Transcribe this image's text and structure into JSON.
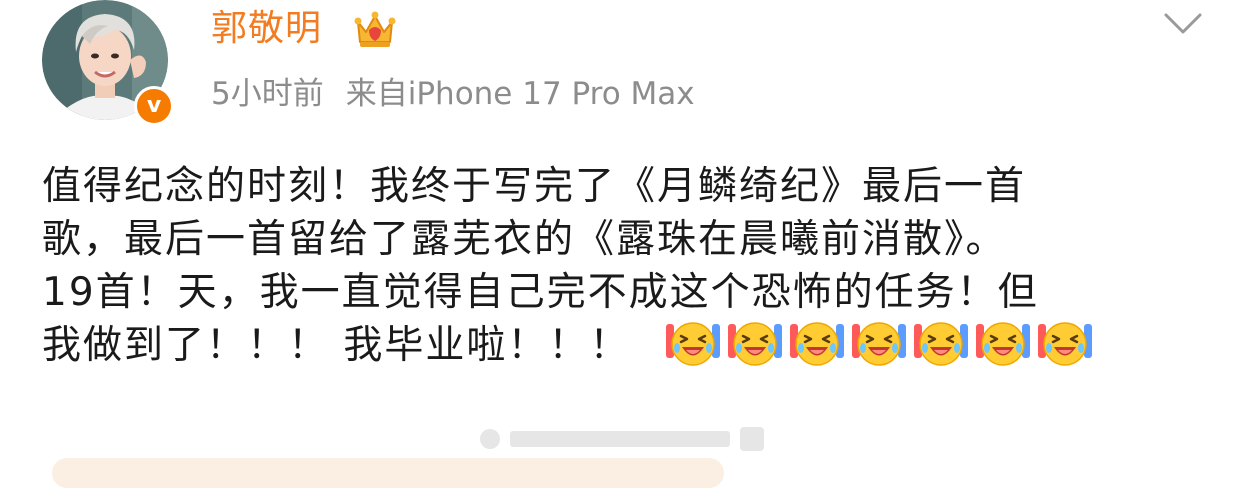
{
  "post": {
    "username": "郭敬明",
    "time": "5小时前",
    "source": "来自iPhone 17 Pro Max",
    "lines": [
      "值得纪念的时刻！我终于写完了《月鳞绮纪》最后一首",
      "歌，最后一首留给了露芜衣的《露珠在晨曦前消散》。",
      "19首！天，我一直觉得自己完不成这个恐怖的任务！但",
      "我做到了！！！ 我毕业啦！！！"
    ],
    "emoji_count": 7,
    "emoji_name": "laughing-crying-emoji",
    "badge_letter": "v"
  },
  "icons": {
    "crown": "crown-icon",
    "chevron": "chevron-down-icon",
    "verified": "verified-badge-icon"
  },
  "colors": {
    "username": "#f27c1f",
    "meta": "#8c8c8c",
    "badge": "#f57c00",
    "text": "#1a1a1a"
  }
}
